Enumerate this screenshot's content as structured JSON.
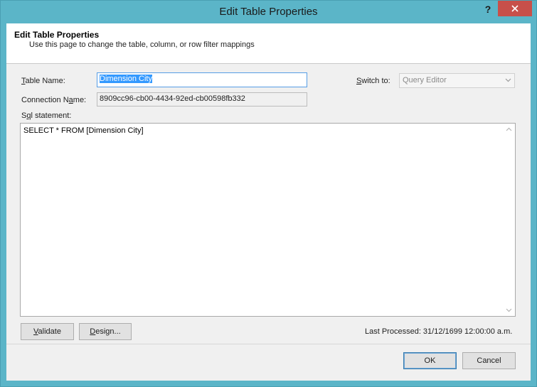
{
  "window": {
    "title": "Edit Table Properties",
    "help_label": "?",
    "close_icon": "close-icon"
  },
  "header": {
    "title": "Edit Table Properties",
    "subtitle": "Use this page to change the table, column, or row filter mappings"
  },
  "form": {
    "table_name_label_prefix": "T",
    "table_name_label_rest": "able Name:",
    "table_name_value": "Dimension City",
    "connection_name_label_prefix": "Connection N",
    "connection_name_label_u": "a",
    "connection_name_label_rest": "me:",
    "connection_name_value": "8909cc96-cb00-4434-92ed-cb00598fb332",
    "switch_to_label_prefix": "S",
    "switch_to_label_rest": "witch to:",
    "switch_to_value": "Query Editor",
    "sql_label_prefix": "S",
    "sql_label_u": "q",
    "sql_label_rest": "l statement:",
    "sql_value": "SELECT * FROM [Dimension City]"
  },
  "actions": {
    "validate_prefix": "",
    "validate_u": "V",
    "validate_rest": "alidate",
    "design_prefix": "",
    "design_u": "D",
    "design_rest": "esign...",
    "last_processed": "Last Processed: 31/12/1699 12:00:00 a.m.",
    "ok_label": "OK",
    "cancel_label": "Cancel"
  },
  "colors": {
    "title_bar": "#5bb5c8",
    "close_button": "#c7504a",
    "selection": "#3399ff"
  }
}
